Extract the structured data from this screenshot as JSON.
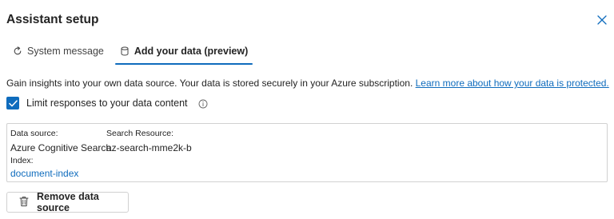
{
  "header": {
    "title": "Assistant setup"
  },
  "tabs": [
    {
      "label": "System message",
      "active": false,
      "icon": "refresh-icon"
    },
    {
      "label": "Add your data (preview)",
      "active": true,
      "icon": "database-icon"
    }
  ],
  "info": {
    "text": "Gain insights into your own data source. Your data is stored securely in your Azure subscription. ",
    "link": "Learn more about how your data is protected."
  },
  "limit": {
    "label": "Limit responses to your data content",
    "checked": true
  },
  "data_source": {
    "source_label": "Data source:",
    "source_value": "Azure Cognitive Search",
    "resource_label": "Search Resource:",
    "resource_value": "az-search-mme2k-b",
    "index_label": "Index:",
    "index_value": "document-index"
  },
  "actions": {
    "remove_label": "Remove data source"
  },
  "colors": {
    "accent": "#0f6cbd",
    "border": "#d1d1d1",
    "text": "#242424"
  }
}
